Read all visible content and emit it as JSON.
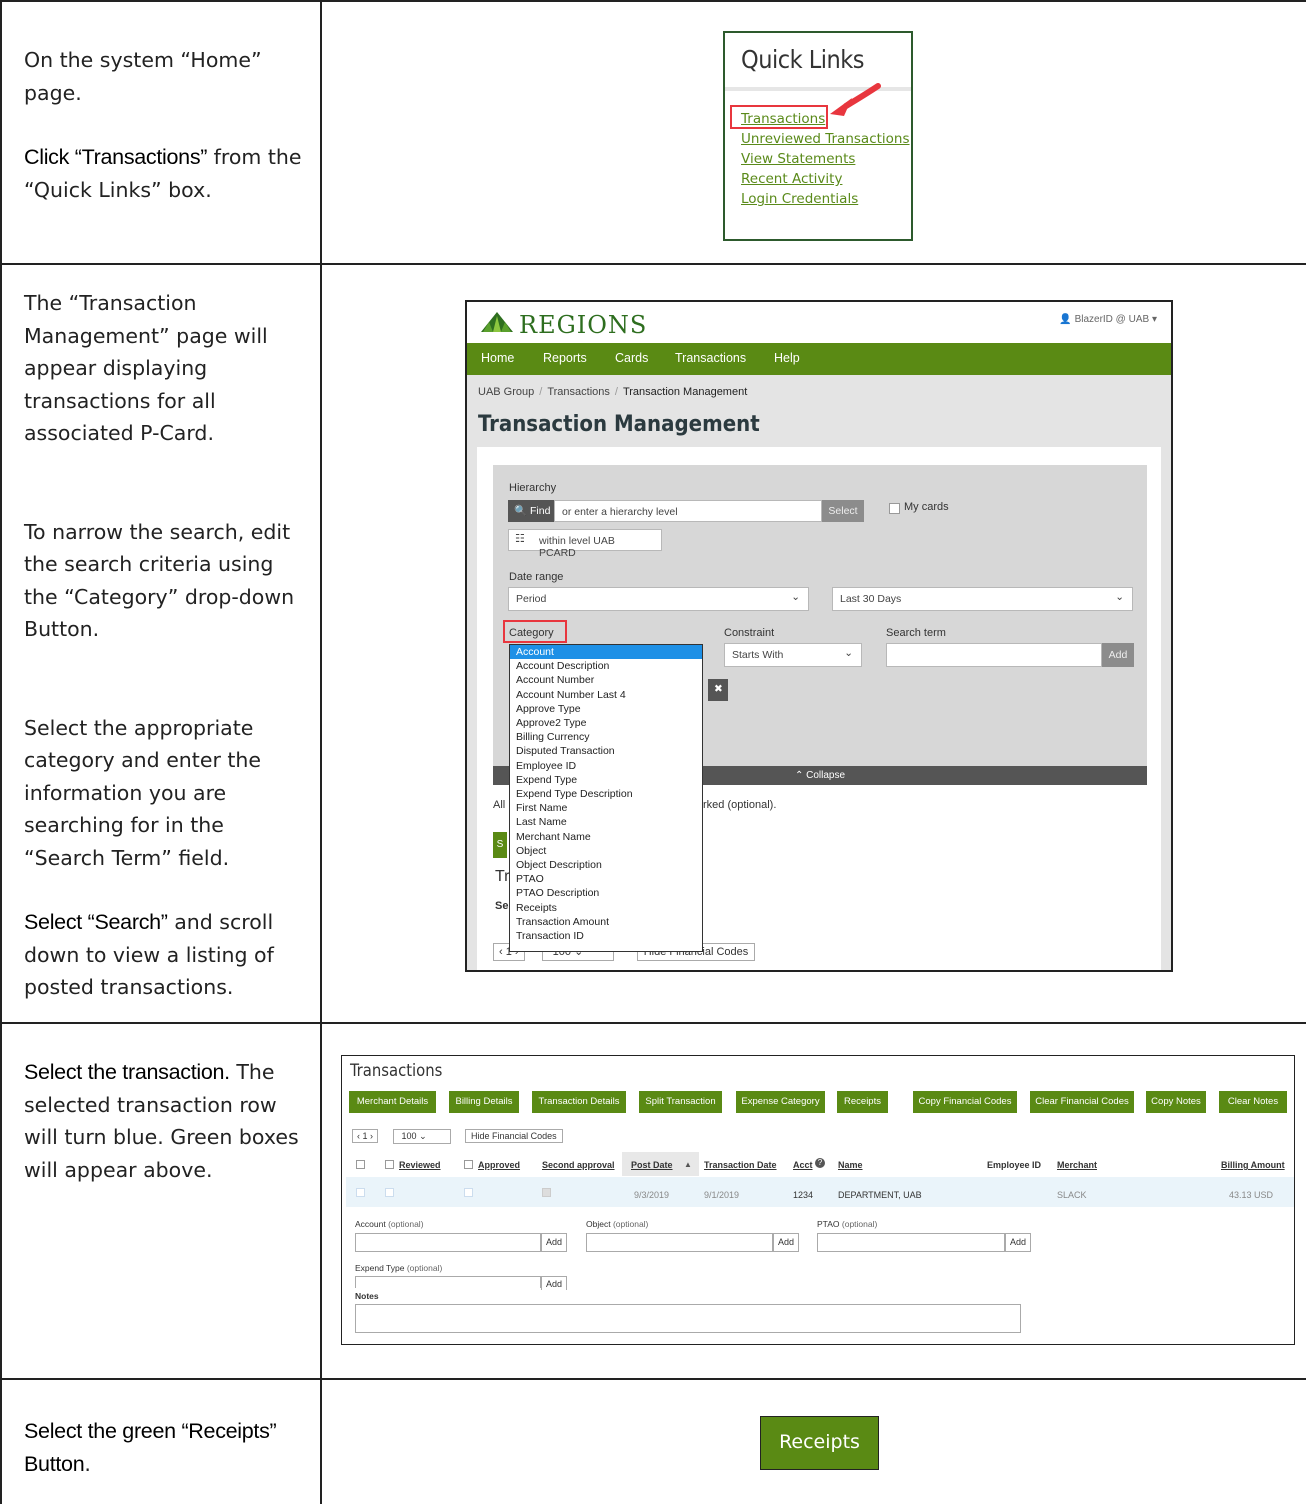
{
  "rows": [
    {
      "paragraphs": [
        {
          "segments": [
            {
              "t": "On the system “Home” page.",
              "b": false
            }
          ]
        },
        {
          "segments": [
            {
              "t": "Click “Transactions”",
              "b": true
            },
            {
              "t": " from the “Quick Links” box.",
              "b": false
            }
          ]
        }
      ]
    },
    {
      "paragraphs": [
        {
          "segments": [
            {
              "t": "The “Transaction Management” page will appear displaying transactions for all associated P-Card.",
              "b": false
            }
          ]
        },
        {
          "segments": [
            {
              "t": "To narrow the search, edit the search criteria using the “Category” drop-down Button.",
              "b": false
            }
          ]
        },
        {
          "segments": [
            {
              "t": "Select the appropriate category and enter the information you are searching for in the “Search Term” field.",
              "b": false
            }
          ]
        },
        {
          "segments": [
            {
              "t": "Select “Search”",
              "b": true
            },
            {
              "t": " and scroll down to view a listing of posted transactions.",
              "b": false
            }
          ]
        }
      ]
    },
    {
      "paragraphs": [
        {
          "segments": [
            {
              "t": "Select the transaction.",
              "b": true
            },
            {
              "t": " The selected transaction row will turn blue. Green boxes will appear above.",
              "b": false
            }
          ]
        }
      ]
    },
    {
      "paragraphs": [
        {
          "segments": [
            {
              "t": "Select the green “Receipts” Button",
              "b": true
            },
            {
              "t": ".",
              "b": false
            }
          ]
        }
      ]
    }
  ],
  "quick_links": {
    "title": "Quick Links",
    "links": [
      "Transactions",
      "Unreviewed Transactions",
      "View Statements",
      "Recent Activity",
      "Login Credentials"
    ]
  },
  "tm": {
    "brand": "REGIONS",
    "user": "BlazerID @ UAB",
    "nav": [
      "Home",
      "Reports",
      "Cards",
      "Transactions",
      "Help"
    ],
    "crumbs": [
      "UAB Group",
      "Transactions",
      "Transaction Management"
    ],
    "title": "Transaction Management",
    "hierarchy_label": "Hierarchy",
    "find_label": "Find",
    "hierarchy_placeholder": "or enter a hierarchy level",
    "select_label": "Select",
    "mycards_label": "My cards",
    "within_level": "within level UAB PCARD",
    "date_range_label": "Date range",
    "period_value": "Period",
    "last_days_value": "Last 30 Days",
    "category_label": "Category",
    "constraint_label": "Constraint",
    "constraint_value": "Starts With",
    "search_term_label": "Search term",
    "add_label": "Add",
    "collapse_label": "Collapse",
    "hint_prefix": "All",
    "hint_suffix": "rked (optional).",
    "partial_s": "S",
    "partial_t": "Tr",
    "partial_se": "Se",
    "pager_page": "1",
    "pager_size": "100",
    "hide_fin_partial": "Hide Financial Codes",
    "category_options": [
      "Account",
      "Account Description",
      "Account Number",
      "Account Number Last 4",
      "Approve Type",
      "Approve2 Type",
      "Billing Currency",
      "Disputed Transaction",
      "Employee ID",
      "Expend Type",
      "Expend Type Description",
      "First Name",
      "Last Name",
      "Merchant Name",
      "Object",
      "Object Description",
      "PTAO",
      "PTAO Description",
      "Receipts",
      "Transaction Amount",
      "Transaction ID"
    ]
  },
  "tx": {
    "title": "Transactions",
    "buttons": [
      "Merchant Details",
      "Billing Details",
      "Transaction Details",
      "Split Transaction",
      "Expense Category",
      "Receipts",
      "Copy Financial Codes",
      "Clear Financial Codes",
      "Copy Notes",
      "Clear Notes"
    ],
    "pager_page": "1",
    "pager_size": "100",
    "hide_fin": "Hide Financial Codes",
    "headers": [
      "Reviewed",
      "Approved",
      "Second approval",
      "Post Date",
      "Transaction Date",
      "Acct",
      "Name",
      "Employee ID",
      "Merchant",
      "Billing Amount"
    ],
    "row": {
      "post_date": "9/3/2019",
      "tx_date": "9/1/2019",
      "acct": "1234",
      "name": "DEPARTMENT, UAB",
      "merchant": "SLACK",
      "amount": "43.13 USD"
    },
    "field_account": "Account",
    "field_object": "Object",
    "field_ptao": "PTAO",
    "field_expend": "Expend Type",
    "optional": "(optional)",
    "add": "Add",
    "notes": "Notes"
  },
  "receipts_button": "Receipts",
  "colors": {
    "brand_green": "#5a8a14",
    "link_green": "#5a8a1a",
    "highlight_red": "#e8363e",
    "select_blue": "#1e90e6"
  }
}
